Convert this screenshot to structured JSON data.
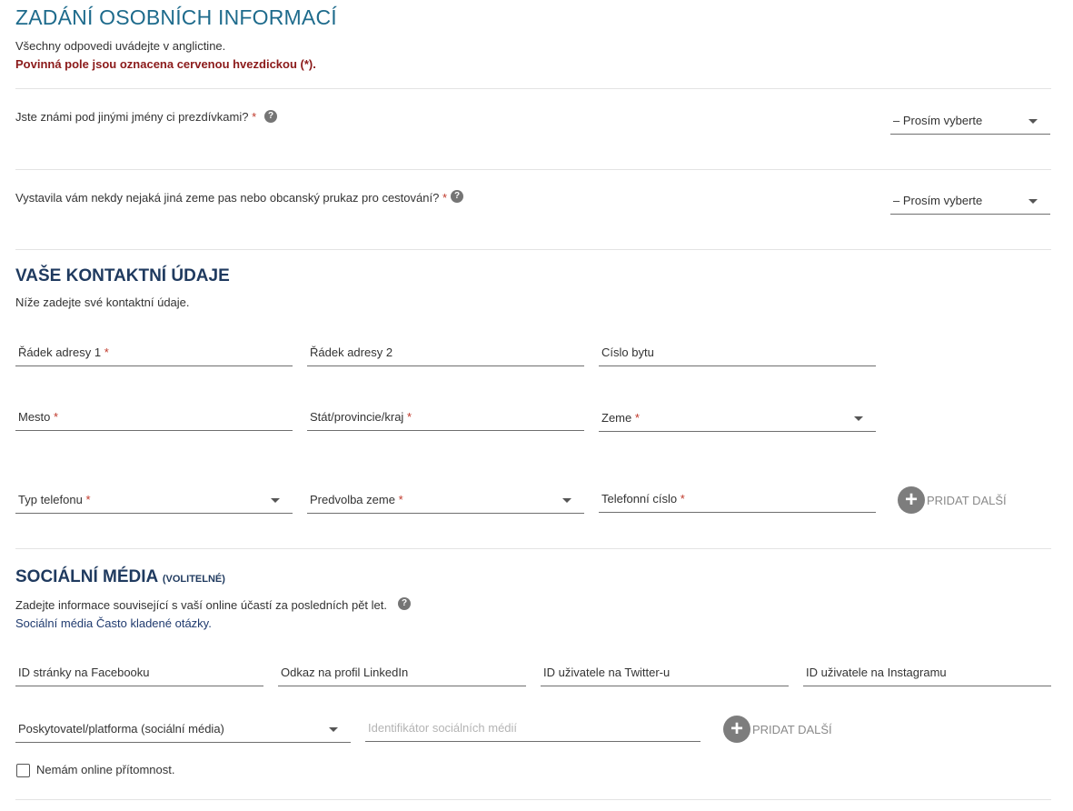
{
  "header": {
    "title": "ZADÁNÍ OSOBNÍCH INFORMACÍ",
    "subtitle": "Všechny odpovedi uvádejte v anglictine.",
    "required_note": "Povinná pole jsou oznacena cervenou hvezdickou (*)."
  },
  "questions": {
    "other_names": {
      "label": "Jste známi pod jinými jmény ci prezdívkami?",
      "required": "*",
      "help": "?",
      "select_value": "– Prosím vyberte"
    },
    "other_passport": {
      "label": "Vystavila vám nekdy nejaká jiná zeme pas nebo obcanský prukaz pro cestování?",
      "required": "*",
      "help": "?",
      "select_value": "– Prosím vyberte"
    }
  },
  "contact": {
    "title": "VAŠE KONTAKTNÍ ÚDAJE",
    "subtitle": "Níže zadejte své kontaktní údaje.",
    "address1": {
      "label": "Řádek adresy 1",
      "required": "*"
    },
    "address2": {
      "label": "Řádek adresy 2"
    },
    "apartment": {
      "label": "Císlo bytu"
    },
    "city": {
      "label": "Mesto",
      "required": "*"
    },
    "state": {
      "label": "Stát/provincie/kraj",
      "required": "*"
    },
    "country": {
      "label": "Zeme",
      "required": "*"
    },
    "phone_type": {
      "label": "Typ telefonu",
      "required": "*"
    },
    "country_code": {
      "label": "Predvolba zeme",
      "required": "*"
    },
    "phone_number": {
      "label": "Telefonní císlo",
      "required": "*"
    },
    "add_more": {
      "icon": "plus-icon",
      "label": "PRIDAT DALŠÍ"
    }
  },
  "social": {
    "title": "SOCIÁLNÍ MÉDIA",
    "title_suffix": "(VOLITELNÉ)",
    "description": "Zadejte informace související s vaší online účastí za posledních pět let.",
    "help": "?",
    "faq_link": "Sociální média Často kladené otázky.",
    "facebook": {
      "label": "ID stránky na Facebooku"
    },
    "linkedin": {
      "label": "Odkaz na profil LinkedIn"
    },
    "twitter": {
      "label": "ID uživatele na Twitter-u"
    },
    "instagram": {
      "label": "ID uživatele na Instagramu"
    },
    "provider": {
      "label": "Poskytovatel/platforma (sociální média)"
    },
    "identifier": {
      "placeholder": "Identifikátor sociálních médií"
    },
    "add_more": {
      "icon": "plus-icon",
      "label": "PRIDAT DALŠÍ"
    },
    "no_presence": {
      "label": "Nemám online přítomnost.",
      "checked": false
    }
  },
  "colors": {
    "title": "#1e6b8c",
    "section_heading": "#1f3a5f",
    "required_star": "#c0392b",
    "required_note": "#8b1a1a"
  }
}
